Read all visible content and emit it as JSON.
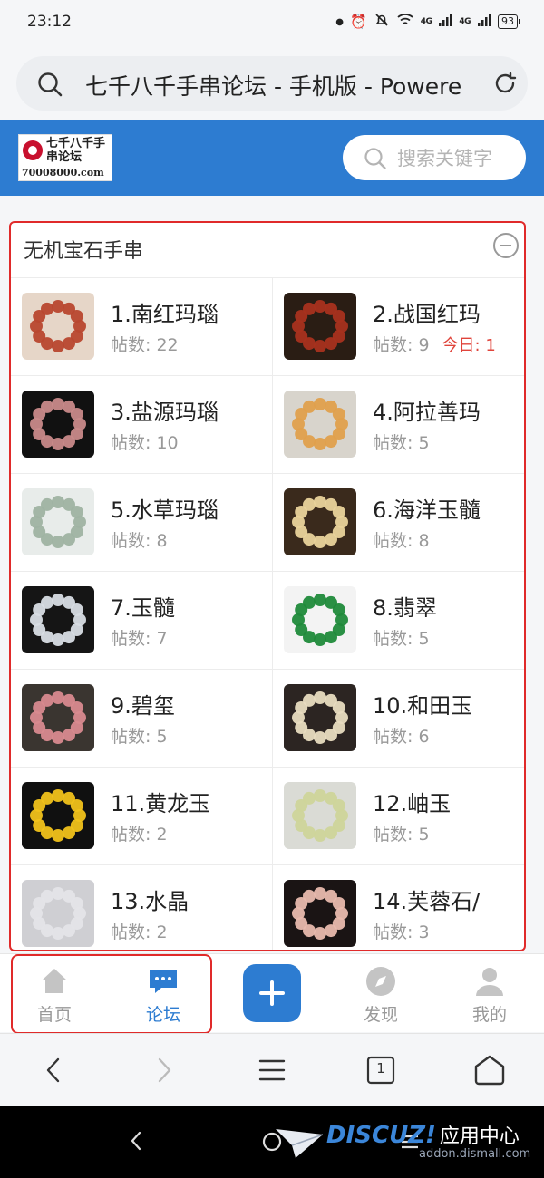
{
  "status_bar": {
    "time": "23:12",
    "net1": "4G",
    "net2": "4G",
    "battery": "93"
  },
  "browser": {
    "address_title": "七千八千手串论坛 - 手机版 - Powere"
  },
  "site": {
    "logo_text": "七千八千手串论坛",
    "logo_url": "70008000.com",
    "search_placeholder": "搜索关键字"
  },
  "section": {
    "title": "无机宝石手串",
    "stats_label": "帖数:",
    "forums": [
      {
        "name": "1.南红玛瑙",
        "posts": "帖数: 22",
        "today": "",
        "colors": [
          "#b8472f",
          "#e6d6c8"
        ]
      },
      {
        "name": "2.战国红玛",
        "posts": "帖数: 9",
        "today": "今日: 1",
        "colors": [
          "#a8321e",
          "#2a1d14"
        ]
      },
      {
        "name": "3.盐源玛瑙",
        "posts": "帖数: 10",
        "today": "",
        "colors": [
          "#c98a8a",
          "#111111"
        ]
      },
      {
        "name": "4.阿拉善玛",
        "posts": "帖数: 5",
        "today": "",
        "colors": [
          "#e0a04c",
          "#d8d4cc"
        ]
      },
      {
        "name": "5.水草玛瑙",
        "posts": "帖数: 8",
        "today": "",
        "colors": [
          "#9fb3a2",
          "#e8ecea"
        ]
      },
      {
        "name": "6.海洋玉髓",
        "posts": "帖数: 8",
        "today": "",
        "colors": [
          "#e9d39b",
          "#3a2a1c"
        ]
      },
      {
        "name": "7.玉髓",
        "posts": "帖数: 7",
        "today": "",
        "colors": [
          "#d8dde4",
          "#151515"
        ]
      },
      {
        "name": "8.翡翠",
        "posts": "帖数: 5",
        "today": "",
        "colors": [
          "#1f8a3a",
          "#f3f3f3"
        ]
      },
      {
        "name": "9.碧玺",
        "posts": "帖数: 5",
        "today": "",
        "colors": [
          "#d88a8f",
          "#3a3530"
        ]
      },
      {
        "name": "10.和田玉",
        "posts": "帖数: 6",
        "today": "",
        "colors": [
          "#e8dcc0",
          "#2c2522"
        ]
      },
      {
        "name": "11.黄龙玉",
        "posts": "帖数: 2",
        "today": "",
        "colors": [
          "#f1c21b",
          "#101010"
        ]
      },
      {
        "name": "12.岫玉",
        "posts": "帖数: 5",
        "today": "",
        "colors": [
          "#cfd59a",
          "#dadbd5"
        ]
      },
      {
        "name": "13.水晶",
        "posts": "帖数: 2",
        "today": "",
        "colors": [
          "#e4e4e8",
          "#cfcfd3"
        ]
      },
      {
        "name": "14.芙蓉石/",
        "posts": "帖数: 3",
        "today": "",
        "colors": [
          "#e8b9ad",
          "#1a1414"
        ]
      }
    ]
  },
  "tab_bar": {
    "tabs": [
      {
        "label": "首页",
        "icon": "home-icon",
        "active": false
      },
      {
        "label": "论坛",
        "icon": "chat-bubble-icon",
        "active": true
      },
      {
        "label": "发现",
        "icon": "compass-icon",
        "active": false
      },
      {
        "label": "我的",
        "icon": "user-icon",
        "active": false
      }
    ],
    "publish_icon": "plus-icon"
  },
  "browser_toolbar": {
    "tab_count": "1"
  },
  "watermark": {
    "brand": "DISCUZ!",
    "brand_suffix": "应用中心",
    "url": "addon.dismall.com"
  },
  "colors": {
    "accent": "#2d7cd1",
    "highlight": "#e02a2a",
    "today": "#e0443b"
  }
}
